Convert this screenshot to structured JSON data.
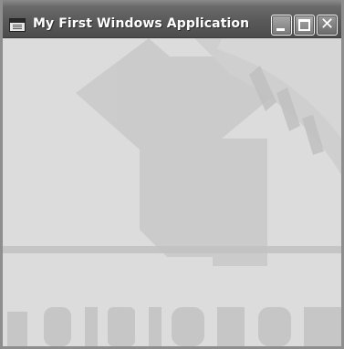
{
  "window": {
    "title": "My First Windows Application"
  },
  "titlebar": {
    "buttons": [
      {
        "name": "minimize",
        "icon": "minimize-icon"
      },
      {
        "name": "maximize",
        "icon": "maximize-icon"
      },
      {
        "name": "close",
        "icon": "close-icon",
        "glyph": "✕"
      }
    ]
  },
  "colors": {
    "titlebar": "#5a5a5a",
    "title_text": "#ffffff",
    "client_background": "#dcdcdc",
    "watermark": "#c6c6c6"
  }
}
